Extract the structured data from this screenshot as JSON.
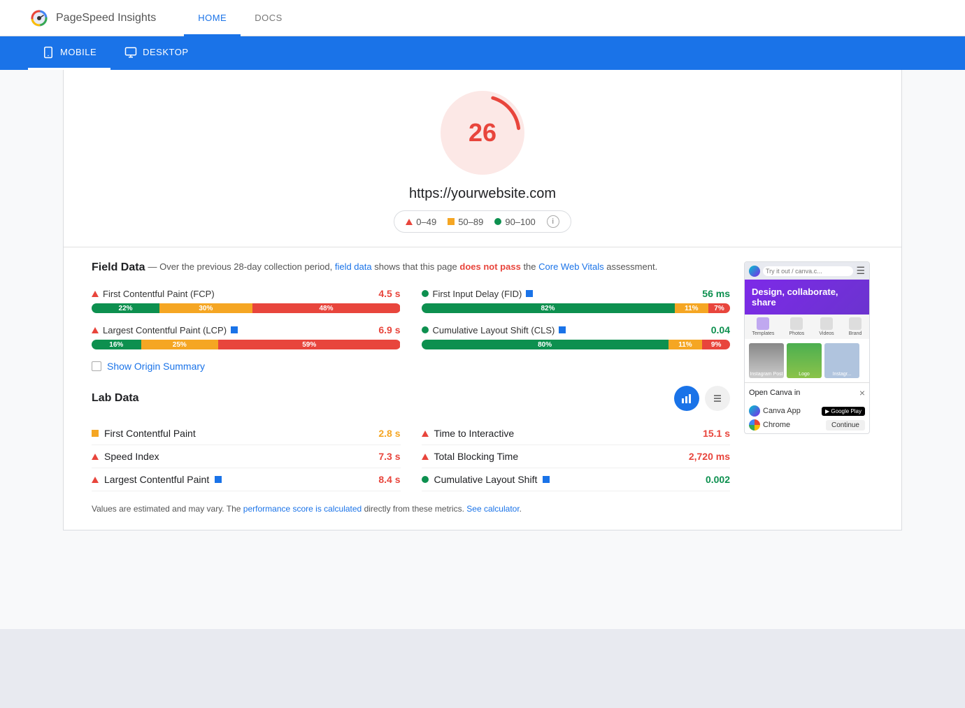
{
  "app": {
    "title": "PageSpeed Insights",
    "logo_alt": "PageSpeed Insights logo"
  },
  "nav": {
    "tabs": [
      {
        "id": "home",
        "label": "HOME",
        "active": true
      },
      {
        "id": "docs",
        "label": "DOCS",
        "active": false
      }
    ]
  },
  "device_tabs": [
    {
      "id": "mobile",
      "label": "MOBILE",
      "active": true
    },
    {
      "id": "desktop",
      "label": "DESKTOP",
      "active": false
    }
  ],
  "score": {
    "value": "26",
    "url": "https://yourwebsite.com",
    "legend": {
      "range1": "0–49",
      "range2": "50–89",
      "range3": "90–100"
    }
  },
  "field_data": {
    "section_title": "Field Data",
    "description_prefix": "— Over the previous 28-day collection period,",
    "link_field_data": "field data",
    "description_mid": "shows that this page",
    "link_does_not_pass": "does not pass",
    "description_suffix": "the",
    "link_core_web_vitals": "Core Web Vitals",
    "description_end": "assessment.",
    "metrics": [
      {
        "id": "fcp",
        "name": "First Contentful Paint (FCP)",
        "value": "4.5 s",
        "status": "red",
        "indicator": "triangle-red",
        "has_flag": false,
        "bar": [
          {
            "color": "green",
            "pct": 22,
            "label": "22%"
          },
          {
            "color": "orange",
            "pct": 30,
            "label": "30%"
          },
          {
            "color": "red",
            "pct": 48,
            "label": "48%"
          }
        ]
      },
      {
        "id": "fid",
        "name": "First Input Delay (FID)",
        "value": "56 ms",
        "status": "green",
        "indicator": "dot-green",
        "has_flag": true,
        "bar": [
          {
            "color": "green",
            "pct": 82,
            "label": "82%"
          },
          {
            "color": "orange",
            "pct": 11,
            "label": "11%"
          },
          {
            "color": "red",
            "pct": 7,
            "label": "7%"
          }
        ]
      },
      {
        "id": "lcp",
        "name": "Largest Contentful Paint (LCP)",
        "value": "6.9 s",
        "status": "red",
        "indicator": "triangle-red",
        "has_flag": true,
        "bar": [
          {
            "color": "green",
            "pct": 16,
            "label": "16%"
          },
          {
            "color": "orange",
            "pct": 25,
            "label": "25%"
          },
          {
            "color": "red",
            "pct": 59,
            "label": "59%"
          }
        ]
      },
      {
        "id": "cls",
        "name": "Cumulative Layout Shift (CLS)",
        "value": "0.04",
        "status": "green",
        "indicator": "dot-green",
        "has_flag": true,
        "bar": [
          {
            "color": "green",
            "pct": 80,
            "label": "80%"
          },
          {
            "color": "orange",
            "pct": 11,
            "label": "11%"
          },
          {
            "color": "red",
            "pct": 9,
            "label": "9%"
          }
        ]
      }
    ],
    "show_origin_label": "Show Origin Summary"
  },
  "lab_data": {
    "section_title": "Lab Data",
    "metrics_left": [
      {
        "id": "fcp_lab",
        "name": "First Contentful Paint",
        "value": "2.8 s",
        "status": "orange",
        "indicator": "square-orange"
      },
      {
        "id": "speed_index",
        "name": "Speed Index",
        "value": "7.3 s",
        "status": "red",
        "indicator": "triangle-red"
      },
      {
        "id": "lcp_lab",
        "name": "Largest Contentful Paint",
        "value": "8.4 s",
        "status": "red",
        "indicator": "triangle-red",
        "has_flag": true
      }
    ],
    "metrics_right": [
      {
        "id": "tti",
        "name": "Time to Interactive",
        "value": "15.1 s",
        "status": "red",
        "indicator": "triangle-red"
      },
      {
        "id": "tbt",
        "name": "Total Blocking Time",
        "value": "2,720 ms",
        "status": "red",
        "indicator": "triangle-red"
      },
      {
        "id": "cls_lab",
        "name": "Cumulative Layout Shift",
        "value": "0.002",
        "status": "green",
        "indicator": "dot-green",
        "has_flag": true
      }
    ]
  },
  "footer": {
    "text_prefix": "Values are estimated and may vary. The",
    "link_perf_score": "performance score is calculated",
    "text_mid": "directly from these metrics.",
    "link_calculator": "See calculator",
    "text_suffix": "."
  },
  "preview": {
    "url_text": "Try it out / canva.c...",
    "hero_text": "Design, collaborate, share",
    "toolbar_items": [
      "Templates",
      "Photos",
      "Videos",
      "Brand"
    ],
    "thumbnails": [
      "Instagram Post",
      "Logo",
      "Instagr..."
    ],
    "open_in_label": "Open Canva in",
    "canva_app_label": "Canva App",
    "chrome_label": "Chrome",
    "continue_label": "Continue"
  }
}
